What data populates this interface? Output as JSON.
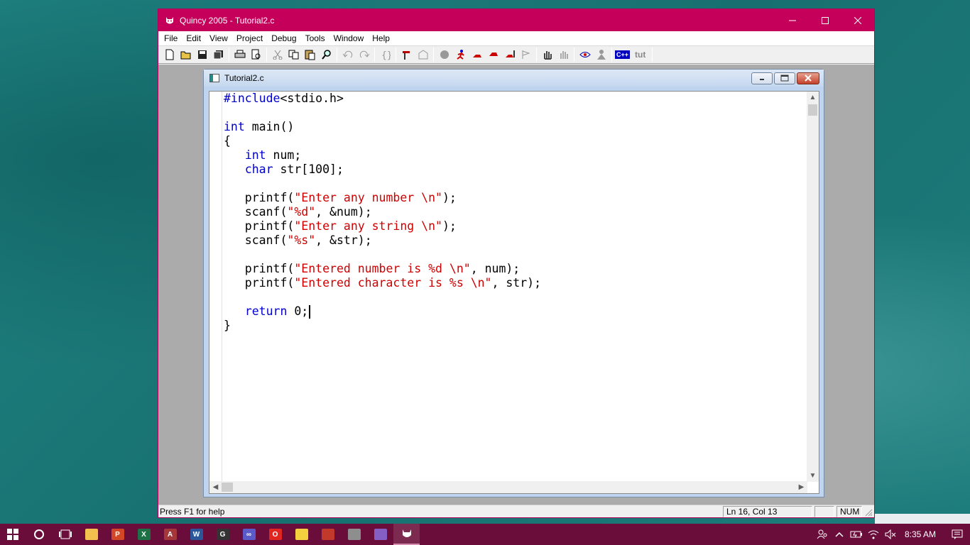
{
  "window": {
    "title": "Quincy 2005 - Tutorial2.c"
  },
  "menu": [
    "File",
    "Edit",
    "View",
    "Project",
    "Debug",
    "Tools",
    "Window",
    "Help"
  ],
  "toolbar": {
    "tut_label": "tut",
    "cpp_label": "C++"
  },
  "document": {
    "title": "Tutorial2.c",
    "lines": [
      [
        {
          "t": "#include",
          "c": "kw"
        },
        {
          "t": "<stdio.h>",
          "c": ""
        }
      ],
      [],
      [
        {
          "t": "int",
          "c": "kw"
        },
        {
          "t": " main()",
          "c": ""
        }
      ],
      [
        {
          "t": "{",
          "c": ""
        }
      ],
      [
        {
          "t": "   ",
          "c": ""
        },
        {
          "t": "int",
          "c": "kw"
        },
        {
          "t": " num;",
          "c": ""
        }
      ],
      [
        {
          "t": "   ",
          "c": ""
        },
        {
          "t": "char",
          "c": "kw"
        },
        {
          "t": " str[100];",
          "c": ""
        }
      ],
      [],
      [
        {
          "t": "   printf(",
          "c": ""
        },
        {
          "t": "\"Enter any number \\n\"",
          "c": "str"
        },
        {
          "t": ");",
          "c": ""
        }
      ],
      [
        {
          "t": "   scanf(",
          "c": ""
        },
        {
          "t": "\"%d\"",
          "c": "str"
        },
        {
          "t": ", &num);",
          "c": ""
        }
      ],
      [
        {
          "t": "   printf(",
          "c": ""
        },
        {
          "t": "\"Enter any string \\n\"",
          "c": "str"
        },
        {
          "t": ");",
          "c": ""
        }
      ],
      [
        {
          "t": "   scanf(",
          "c": ""
        },
        {
          "t": "\"%s\"",
          "c": "str"
        },
        {
          "t": ", &str);",
          "c": ""
        }
      ],
      [],
      [
        {
          "t": "   printf(",
          "c": ""
        },
        {
          "t": "\"Entered number is %d \\n\"",
          "c": "str"
        },
        {
          "t": ", num);",
          "c": ""
        }
      ],
      [
        {
          "t": "   printf(",
          "c": ""
        },
        {
          "t": "\"Entered character is %s \\n\"",
          "c": "str"
        },
        {
          "t": ", str);",
          "c": ""
        }
      ],
      [],
      [
        {
          "t": "   ",
          "c": ""
        },
        {
          "t": "return",
          "c": "kw"
        },
        {
          "t": " 0;",
          "c": ""
        }
      ],
      [
        {
          "t": "}",
          "c": ""
        }
      ]
    ],
    "caret_line": 15
  },
  "status": {
    "help": "Press F1 for help",
    "position": "Ln 16, Col 13",
    "num": "NUM"
  },
  "taskbar": {
    "clock": "8:35 AM",
    "apps": [
      {
        "name": "file-explorer",
        "label": "",
        "color": "#f2c14e"
      },
      {
        "name": "powerpoint",
        "label": "P",
        "color": "#d24726"
      },
      {
        "name": "excel",
        "label": "X",
        "color": "#1e7145"
      },
      {
        "name": "access",
        "label": "A",
        "color": "#a4373a"
      },
      {
        "name": "word",
        "label": "W",
        "color": "#2b579a"
      },
      {
        "name": "app-g",
        "label": "G",
        "color": "#333333"
      },
      {
        "name": "app-infinity",
        "label": "∞",
        "color": "#5a5ac8"
      },
      {
        "name": "opera",
        "label": "O",
        "color": "#e0261f"
      },
      {
        "name": "sticky-notes",
        "label": "",
        "color": "#f4d03f"
      },
      {
        "name": "paint",
        "label": "",
        "color": "#c0392b"
      },
      {
        "name": "paint-3d",
        "label": "",
        "color": "#8e8e8e"
      },
      {
        "name": "visual-studio",
        "label": "",
        "color": "#865fc5"
      },
      {
        "name": "quincy",
        "label": "",
        "color": "#ffffff"
      }
    ]
  },
  "colors": {
    "titlebar": "#c4005a",
    "taskbar": "#6b0d3a",
    "keyword": "#0000cc",
    "string": "#d00000"
  }
}
